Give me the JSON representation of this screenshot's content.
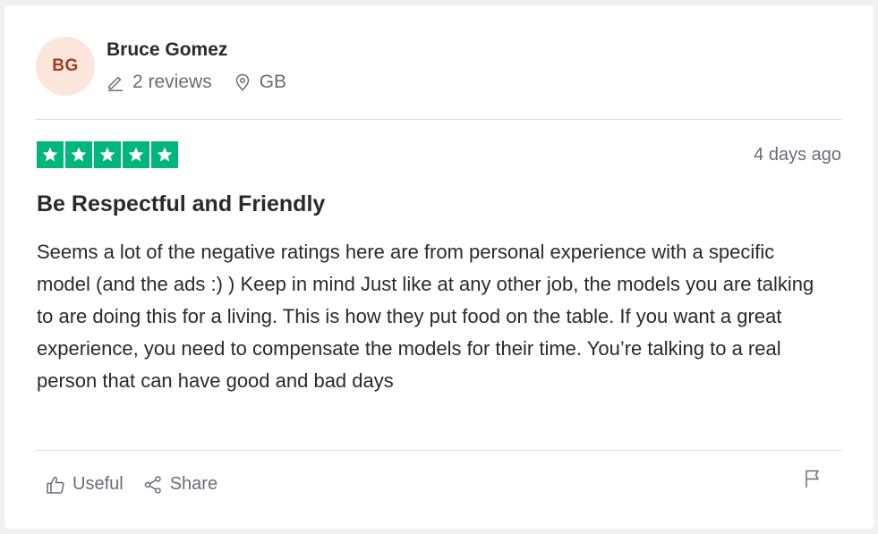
{
  "reviewer": {
    "initials": "BG",
    "name": "Bruce Gomez",
    "reviews_count": "2 reviews",
    "country": "GB",
    "avatar_bg": "#fce6dc",
    "avatar_fg": "#9f3f1d"
  },
  "review": {
    "rating": 5,
    "rating_max": 5,
    "star_color": "#00b67a",
    "date": "4 days ago",
    "title": "Be Respectful and Friendly",
    "body": "Seems a lot of the negative ratings here are from personal experience with a specific model (and the ads :) ) Keep in mind Just like at any other job, the models you are talking to are doing this for a living. This is how they put food on the table. If you want a great experience, you need to compensate the models for their time. You’re talking to a real person that can have good and bad days"
  },
  "actions": {
    "useful_label": "Useful",
    "share_label": "Share"
  },
  "icons": {
    "reviews": "pencil-icon",
    "location": "location-pin-icon",
    "useful": "thumbs-up-icon",
    "share": "share-icon",
    "report": "flag-icon"
  }
}
